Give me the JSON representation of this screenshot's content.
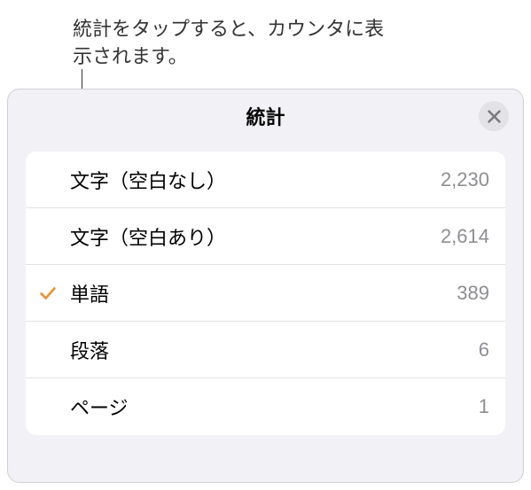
{
  "callout": {
    "text": "統計をタップすると、カウンタに表示されます。"
  },
  "panel": {
    "title": "統計"
  },
  "rows": [
    {
      "label": "文字（空白なし）",
      "value": "2,230",
      "checked": false
    },
    {
      "label": "文字（空白あり）",
      "value": "2,614",
      "checked": false
    },
    {
      "label": "単語",
      "value": "389",
      "checked": true
    },
    {
      "label": "段落",
      "value": "6",
      "checked": false
    },
    {
      "label": "ページ",
      "value": "1",
      "checked": false
    }
  ]
}
